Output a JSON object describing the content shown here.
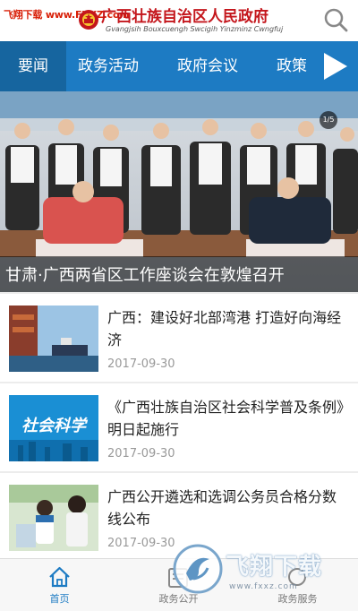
{
  "watermark": "飞翔下载 www.FXXZ.com",
  "header": {
    "title": "广西壮族自治区人民政府",
    "subtitle": "Gvangjsih Bouxcuengh Swcigih Yinzminz Cwngfuj"
  },
  "nav": {
    "tabs": [
      {
        "label": "要闻"
      },
      {
        "label": "政务活动"
      },
      {
        "label": "政府会议"
      },
      {
        "label": "政策"
      }
    ]
  },
  "hero": {
    "caption": "甘肃·广西两省区工作座谈会在敦煌召开",
    "counter": "1/5"
  },
  "news": [
    {
      "title": "广西：建设好北部湾港 打造好向海经济",
      "date": "2017-09-30"
    },
    {
      "title": "《广西壮族自治区社会科学普及条例》明日起施行",
      "date": "2017-09-30",
      "thumb_text": "社会科学"
    },
    {
      "title": "广西公开遴选和选调公务员合格分数线公布",
      "date": "2017-09-30"
    }
  ],
  "tabbar": {
    "items": [
      {
        "label": "首页"
      },
      {
        "label": "政务公开"
      },
      {
        "label": "政务服务"
      }
    ]
  },
  "logo_watermark": {
    "text": "飞翔下载",
    "sub": "www.fxxz.com"
  },
  "colors": {
    "brand_blue": "#1d7bc3",
    "title_red": "#c4161c",
    "watermark_red": "#d81e06"
  }
}
